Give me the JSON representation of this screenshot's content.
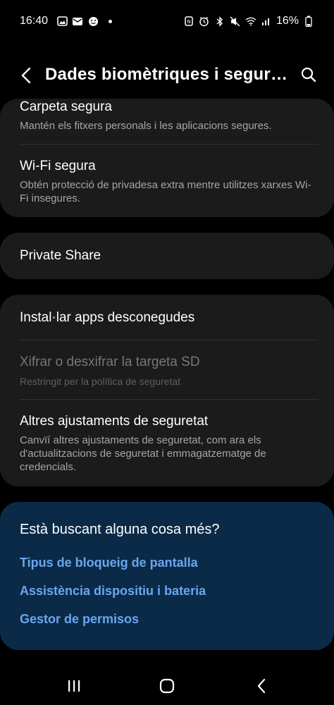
{
  "status_bar": {
    "time": "16:40",
    "battery_percent": "16%",
    "left_icons": [
      "gallery-icon",
      "mail-icon",
      "smiley-icon"
    ],
    "right_icons": [
      "nfc-icon",
      "alarm-icon",
      "bluetooth-icon",
      "mute-icon",
      "wifi-icon",
      "signal-icon",
      "battery-icon"
    ]
  },
  "app_bar": {
    "title": "Dades biomètriques i segure…"
  },
  "cards": {
    "secure_folder": {
      "title": "Carpeta segura",
      "subtitle": "Mantén els fitxers personals i les aplicacions segures."
    },
    "secure_wifi": {
      "title": "Wi-Fi segura",
      "subtitle": "Obtén protecció de privadesa extra mentre utilitzes xarxes Wi-Fi insegures."
    },
    "private_share": {
      "title": "Private Share"
    },
    "install_unknown": {
      "title": "Instal·lar apps desconegudes"
    },
    "encrypt_sd": {
      "title": "Xifrar o desxifrar la targeta SD",
      "subtitle": "Restringit per la política de seguretat"
    },
    "other_security": {
      "title": "Altres ajustaments de seguretat",
      "subtitle": "Canvïí altres ajustaments de seguretat, com ara els d'actualitzacions de seguretat i emmagatzematge de credencials."
    }
  },
  "suggestions": {
    "title": "Està buscant alguna cosa més?",
    "links": [
      "Tipus de bloqueig de pantalla",
      "Assistència dispositiu i bateria",
      "Gestor de permisos"
    ]
  },
  "colors": {
    "background": "#000000",
    "card": "#1b1b1b",
    "suggest_card": "#0b2a47",
    "link": "#6aa6f0",
    "subtitle": "#a6a6a6"
  }
}
